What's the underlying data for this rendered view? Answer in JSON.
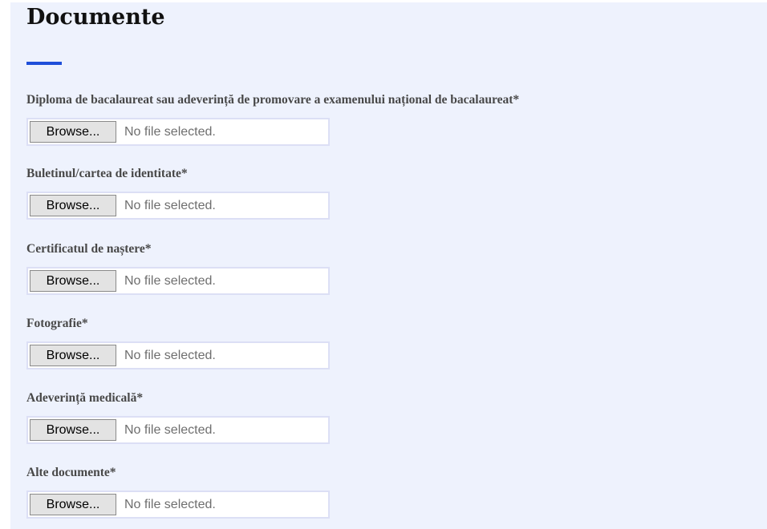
{
  "section": {
    "title": "Documente"
  },
  "fields": [
    {
      "label": "Diploma de bacalaureat sau adeverință de promovare a examenului național de bacalaureat*",
      "button_label": "Browse...",
      "status": "No file selected."
    },
    {
      "label": "Buletinul/cartea de identitate*",
      "button_label": "Browse...",
      "status": "No file selected."
    },
    {
      "label": "Certificatul de naștere*",
      "button_label": "Browse...",
      "status": "No file selected."
    },
    {
      "label": "Fotografie*",
      "button_label": "Browse...",
      "status": "No file selected."
    },
    {
      "label": "Adeverință medicală*",
      "button_label": "Browse...",
      "status": "No file selected."
    },
    {
      "label": "Alte documente*",
      "button_label": "Browse...",
      "status": "No file selected."
    }
  ],
  "colors": {
    "panel_background": "#eef2fd",
    "accent": "#1f4fd9",
    "label_text": "#484848",
    "input_border": "#dcdff5"
  }
}
